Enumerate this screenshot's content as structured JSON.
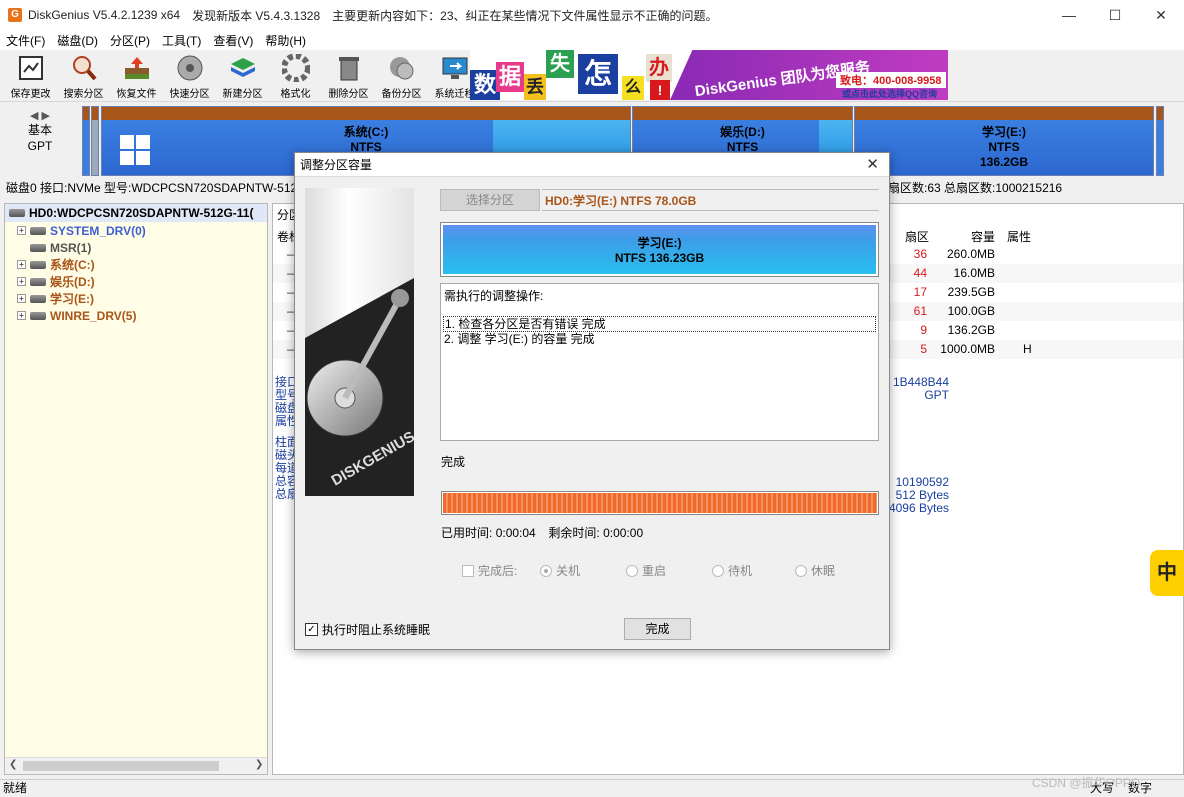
{
  "window": {
    "app_name": "DiskGenius V5.4.2.1239 x64",
    "update_text": "发现新版本 V5.4.3.1328",
    "update_detail": "主要更新内容如下：23、纠正在某些情况下文件属性显示不正确的问题。"
  },
  "menu": [
    "文件(F)",
    "磁盘(D)",
    "分区(P)",
    "工具(T)",
    "查看(V)",
    "帮助(H)"
  ],
  "toolbar": [
    {
      "label": "保存更改",
      "icon": "save-icon"
    },
    {
      "label": "搜索分区",
      "icon": "search-icon"
    },
    {
      "label": "恢复文件",
      "icon": "recover-icon"
    },
    {
      "label": "快速分区",
      "icon": "disk-icon"
    },
    {
      "label": "新建分区",
      "icon": "new-partition-icon"
    },
    {
      "label": "格式化",
      "icon": "format-icon"
    },
    {
      "label": "删除分区",
      "icon": "trash-icon"
    },
    {
      "label": "备份分区",
      "icon": "backup-icon"
    },
    {
      "label": "系统迁移",
      "icon": "migrate-icon"
    }
  ],
  "banner": {
    "chars": [
      "数",
      "据",
      "丢",
      "失",
      "怎",
      "么",
      "办",
      "!"
    ],
    "slogan": "DiskGenius 团队为您服务",
    "phone": "致电：400-008-9958",
    "qq": "或点击此处选择QQ咨询"
  },
  "disk_side": {
    "type": "基本",
    "style": "GPT"
  },
  "partitions": [
    {
      "name": "系统(C:)",
      "fs": "NTFS",
      "size": ""
    },
    {
      "name": "娱乐(D:)",
      "fs": "NTFS",
      "size": ""
    },
    {
      "name": "学习(E:)",
      "fs": "NTFS",
      "size": "136.2GB"
    }
  ],
  "info_line": "磁盘0 接口:NVMe  型号:WDCPCSN720SDAPNTW-512",
  "info_line_right": "扇区数:63  总扇区数:1000215216",
  "tree": {
    "root": "HD0:WDCPCSN720SDAPNTW-512G-11(",
    "nodes": [
      {
        "label": "SYSTEM_DRV(0)",
        "color": "#3f5fd0",
        "expand": true
      },
      {
        "label": "MSR(1)",
        "color": "#555555",
        "expand": false
      },
      {
        "label": "系统(C:)",
        "color": "#a8551a",
        "expand": true
      },
      {
        "label": "娱乐(D:)",
        "color": "#a8551a",
        "expand": true
      },
      {
        "label": "学习(E:)",
        "color": "#a8551a",
        "expand": true
      },
      {
        "label": "WINRE_DRV(5)",
        "color": "#a8551a",
        "expand": true
      }
    ]
  },
  "right_panel": {
    "tab": "分区",
    "col_left": "卷标",
    "headers": [
      "扇区",
      "容量",
      "属性"
    ],
    "rows": [
      {
        "sector": "36",
        "size": "260.0MB",
        "attr": ""
      },
      {
        "sector": "44",
        "size": "16.0MB",
        "attr": ""
      },
      {
        "sector": "17",
        "size": "239.5GB",
        "attr": ""
      },
      {
        "sector": "61",
        "size": "100.0GB",
        "attr": ""
      },
      {
        "sector": "9",
        "size": "136.2GB",
        "attr": ""
      },
      {
        "sector": "5",
        "size": "1000.0MB",
        "attr": "H"
      }
    ],
    "left_labels_a": [
      "接口",
      "型号",
      "磁盘",
      "属性"
    ],
    "left_labels_b": [
      "柱面",
      "磁头",
      "每道",
      "总容",
      "总扇"
    ],
    "right_values_a": [
      "1B448B44",
      "GPT"
    ],
    "right_values_b": [
      "10190592",
      "512 Bytes",
      "4096 Bytes"
    ]
  },
  "dialog": {
    "title": "调整分区容量",
    "select_button": "选择分区",
    "selected_partition": "HD0:学习(E:) NTFS 78.0GB",
    "partition_name": "学习(E:)",
    "partition_info": "NTFS 136.23GB",
    "ops_title": "需执行的调整操作:",
    "ops": [
      "1. 检查各分区是否有错误    完成",
      "2. 调整 学习(E:) 的容量    完成"
    ],
    "status": "完成",
    "progress": 1.0,
    "elapsed_label": "已用时间:",
    "elapsed": "0:00:04",
    "remaining_label": "剩余时间:",
    "remaining": "0:00:00",
    "after_label": "完成后:",
    "after_options": [
      "关机",
      "重启",
      "待机",
      "休眠"
    ],
    "after_selected": "关机",
    "prevent_sleep_label": "执行时阻止系统睡眠",
    "prevent_sleep_checked": true,
    "done_button": "完成",
    "image_caption": "DISKGENIUS"
  },
  "status_bar": {
    "left": "就绪",
    "caps": "大写",
    "num": "数字"
  },
  "watermark": "CSDN @振华OPPO",
  "ime": "中"
}
